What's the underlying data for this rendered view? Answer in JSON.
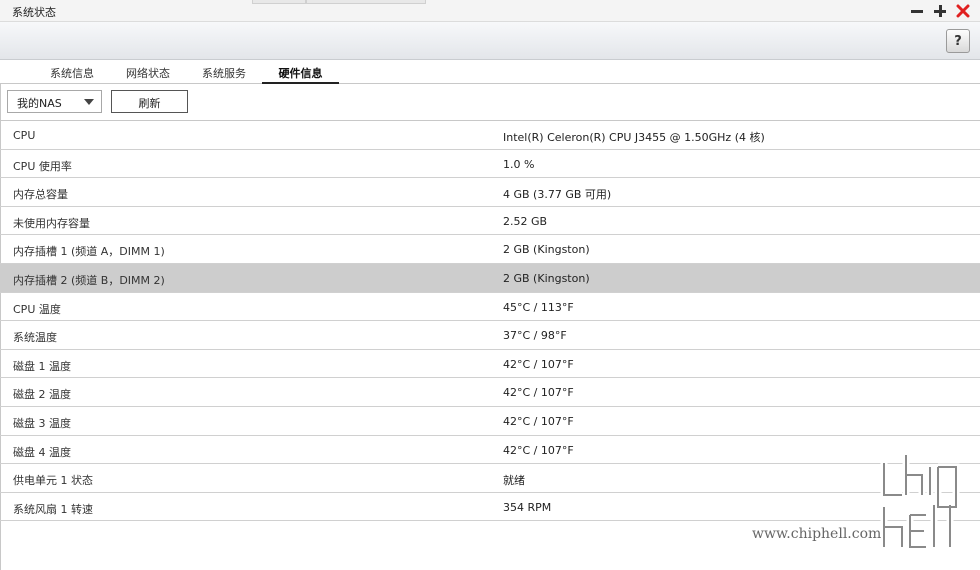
{
  "window": {
    "title": "系统状态",
    "controls": [
      "minimize-icon",
      "maximize-icon",
      "close-icon"
    ],
    "close_color": "#e02020"
  },
  "toolbar": {
    "help_label": "?"
  },
  "tabs": [
    {
      "label": "系统信息",
      "active": false
    },
    {
      "label": "网络状态",
      "active": false
    },
    {
      "label": "系统服务",
      "active": false
    },
    {
      "label": "硬件信息",
      "active": true
    }
  ],
  "controls": {
    "device_select": "我的NAS",
    "refresh_label": "刷新"
  },
  "hardware": [
    {
      "key": "CPU",
      "value": "Intel(R) Celeron(R) CPU J3455 @ 1.50GHz (4 核)"
    },
    {
      "key": "CPU 使用率",
      "value": "1.0 %"
    },
    {
      "key": "内存总容量",
      "value": "4 GB (3.77 GB 可用)"
    },
    {
      "key": "未使用内存容量",
      "value": "2.52 GB"
    },
    {
      "key": "内存插槽 1 (频道 A，DIMM 1)",
      "value": "2 GB (Kingston)"
    },
    {
      "key": "内存插槽 2 (频道 B，DIMM 2)",
      "value": "2 GB (Kingston)",
      "selected": true
    },
    {
      "key": "CPU 温度",
      "value": "45°C / 113°F"
    },
    {
      "key": "系统温度",
      "value": "37°C / 98°F"
    },
    {
      "key": "磁盘 1 温度",
      "value": "42°C / 107°F"
    },
    {
      "key": "磁盘 2 温度",
      "value": "42°C / 107°F"
    },
    {
      "key": "磁盘 3 温度",
      "value": "42°C / 107°F"
    },
    {
      "key": "磁盘 4 温度",
      "value": "42°C / 107°F"
    },
    {
      "key": "供电单元 1 状态",
      "value": "就绪"
    },
    {
      "key": "系统风扇 1 转速",
      "value": "354 RPM"
    }
  ],
  "watermark": {
    "site": "www.chiphell.com",
    "logo": "chiphell-logo"
  }
}
